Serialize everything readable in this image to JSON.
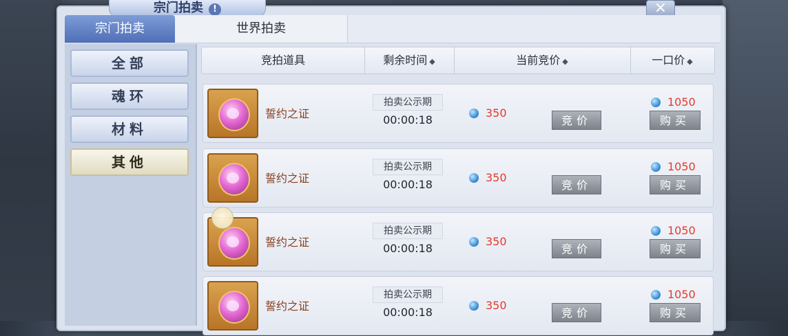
{
  "window": {
    "title": "宗门拍卖",
    "info_icon": "info-icon",
    "close_icon": "close-icon"
  },
  "tabs": [
    {
      "label": "宗门拍卖",
      "active": true
    },
    {
      "label": "世界拍卖",
      "active": false
    }
  ],
  "sidebar": {
    "items": [
      {
        "label": "全部",
        "active": false
      },
      {
        "label": "魂环",
        "active": false
      },
      {
        "label": "材料",
        "active": false
      },
      {
        "label": "其他",
        "active": true
      }
    ]
  },
  "table": {
    "headers": {
      "item": "竞拍道具",
      "time": "剩余时间",
      "current_bid": "当前竞价",
      "buyout": "一口价"
    },
    "sort_icon": "sort-icon",
    "rows": [
      {
        "name": "誓约之证",
        "time_label": "拍卖公示期",
        "time": "00:00:18",
        "bid": "350",
        "bid_button": "竞价",
        "buyout": "1050",
        "buy_button": "购买"
      },
      {
        "name": "誓约之证",
        "time_label": "拍卖公示期",
        "time": "00:00:18",
        "bid": "350",
        "bid_button": "竞价",
        "buyout": "1050",
        "buy_button": "购买"
      },
      {
        "name": "誓约之证",
        "time_label": "拍卖公示期",
        "time": "00:00:18",
        "bid": "350",
        "bid_button": "竞价",
        "buyout": "1050",
        "buy_button": "购买"
      },
      {
        "name": "誓约之证",
        "time_label": "拍卖公示期",
        "time": "00:00:18",
        "bid": "350",
        "bid_button": "竞价",
        "buyout": "1050",
        "buy_button": "购买"
      }
    ]
  },
  "colors": {
    "price": "#e43a2c",
    "item_name": "#8a3f1c",
    "active_tab": "#4f6fb8"
  }
}
